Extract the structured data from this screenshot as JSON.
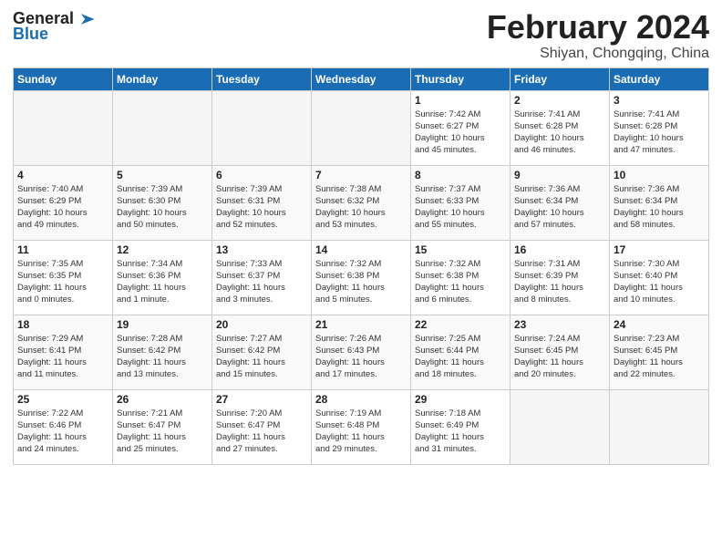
{
  "header": {
    "logo_line1": "General",
    "logo_line2": "Blue",
    "month": "February 2024",
    "location": "Shiyan, Chongqing, China"
  },
  "weekdays": [
    "Sunday",
    "Monday",
    "Tuesday",
    "Wednesday",
    "Thursday",
    "Friday",
    "Saturday"
  ],
  "weeks": [
    [
      {
        "day": "",
        "info": ""
      },
      {
        "day": "",
        "info": ""
      },
      {
        "day": "",
        "info": ""
      },
      {
        "day": "",
        "info": ""
      },
      {
        "day": "1",
        "info": "Sunrise: 7:42 AM\nSunset: 6:27 PM\nDaylight: 10 hours\nand 45 minutes."
      },
      {
        "day": "2",
        "info": "Sunrise: 7:41 AM\nSunset: 6:28 PM\nDaylight: 10 hours\nand 46 minutes."
      },
      {
        "day": "3",
        "info": "Sunrise: 7:41 AM\nSunset: 6:28 PM\nDaylight: 10 hours\nand 47 minutes."
      }
    ],
    [
      {
        "day": "4",
        "info": "Sunrise: 7:40 AM\nSunset: 6:29 PM\nDaylight: 10 hours\nand 49 minutes."
      },
      {
        "day": "5",
        "info": "Sunrise: 7:39 AM\nSunset: 6:30 PM\nDaylight: 10 hours\nand 50 minutes."
      },
      {
        "day": "6",
        "info": "Sunrise: 7:39 AM\nSunset: 6:31 PM\nDaylight: 10 hours\nand 52 minutes."
      },
      {
        "day": "7",
        "info": "Sunrise: 7:38 AM\nSunset: 6:32 PM\nDaylight: 10 hours\nand 53 minutes."
      },
      {
        "day": "8",
        "info": "Sunrise: 7:37 AM\nSunset: 6:33 PM\nDaylight: 10 hours\nand 55 minutes."
      },
      {
        "day": "9",
        "info": "Sunrise: 7:36 AM\nSunset: 6:34 PM\nDaylight: 10 hours\nand 57 minutes."
      },
      {
        "day": "10",
        "info": "Sunrise: 7:36 AM\nSunset: 6:34 PM\nDaylight: 10 hours\nand 58 minutes."
      }
    ],
    [
      {
        "day": "11",
        "info": "Sunrise: 7:35 AM\nSunset: 6:35 PM\nDaylight: 11 hours\nand 0 minutes."
      },
      {
        "day": "12",
        "info": "Sunrise: 7:34 AM\nSunset: 6:36 PM\nDaylight: 11 hours\nand 1 minute."
      },
      {
        "day": "13",
        "info": "Sunrise: 7:33 AM\nSunset: 6:37 PM\nDaylight: 11 hours\nand 3 minutes."
      },
      {
        "day": "14",
        "info": "Sunrise: 7:32 AM\nSunset: 6:38 PM\nDaylight: 11 hours\nand 5 minutes."
      },
      {
        "day": "15",
        "info": "Sunrise: 7:32 AM\nSunset: 6:38 PM\nDaylight: 11 hours\nand 6 minutes."
      },
      {
        "day": "16",
        "info": "Sunrise: 7:31 AM\nSunset: 6:39 PM\nDaylight: 11 hours\nand 8 minutes."
      },
      {
        "day": "17",
        "info": "Sunrise: 7:30 AM\nSunset: 6:40 PM\nDaylight: 11 hours\nand 10 minutes."
      }
    ],
    [
      {
        "day": "18",
        "info": "Sunrise: 7:29 AM\nSunset: 6:41 PM\nDaylight: 11 hours\nand 11 minutes."
      },
      {
        "day": "19",
        "info": "Sunrise: 7:28 AM\nSunset: 6:42 PM\nDaylight: 11 hours\nand 13 minutes."
      },
      {
        "day": "20",
        "info": "Sunrise: 7:27 AM\nSunset: 6:42 PM\nDaylight: 11 hours\nand 15 minutes."
      },
      {
        "day": "21",
        "info": "Sunrise: 7:26 AM\nSunset: 6:43 PM\nDaylight: 11 hours\nand 17 minutes."
      },
      {
        "day": "22",
        "info": "Sunrise: 7:25 AM\nSunset: 6:44 PM\nDaylight: 11 hours\nand 18 minutes."
      },
      {
        "day": "23",
        "info": "Sunrise: 7:24 AM\nSunset: 6:45 PM\nDaylight: 11 hours\nand 20 minutes."
      },
      {
        "day": "24",
        "info": "Sunrise: 7:23 AM\nSunset: 6:45 PM\nDaylight: 11 hours\nand 22 minutes."
      }
    ],
    [
      {
        "day": "25",
        "info": "Sunrise: 7:22 AM\nSunset: 6:46 PM\nDaylight: 11 hours\nand 24 minutes."
      },
      {
        "day": "26",
        "info": "Sunrise: 7:21 AM\nSunset: 6:47 PM\nDaylight: 11 hours\nand 25 minutes."
      },
      {
        "day": "27",
        "info": "Sunrise: 7:20 AM\nSunset: 6:47 PM\nDaylight: 11 hours\nand 27 minutes."
      },
      {
        "day": "28",
        "info": "Sunrise: 7:19 AM\nSunset: 6:48 PM\nDaylight: 11 hours\nand 29 minutes."
      },
      {
        "day": "29",
        "info": "Sunrise: 7:18 AM\nSunset: 6:49 PM\nDaylight: 11 hours\nand 31 minutes."
      },
      {
        "day": "",
        "info": ""
      },
      {
        "day": "",
        "info": ""
      }
    ]
  ]
}
